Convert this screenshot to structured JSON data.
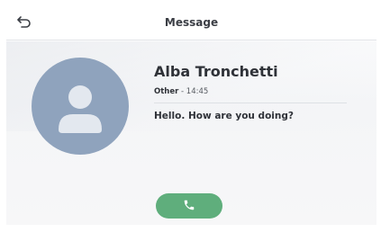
{
  "header": {
    "title": "Message",
    "back_icon": "back-arrow-icon"
  },
  "contact": {
    "name": "Alba Tronchetti",
    "type": "Other",
    "separator": " - ",
    "time": "14:45",
    "avatar_icon": "person-icon"
  },
  "message": {
    "text": "Hello. How are you doing?"
  },
  "actions": {
    "call_icon": "phone-icon"
  },
  "colors": {
    "call_button": "#5fae7c",
    "avatar_bg": "#8fa3bd",
    "text_primary": "#2f3238"
  }
}
